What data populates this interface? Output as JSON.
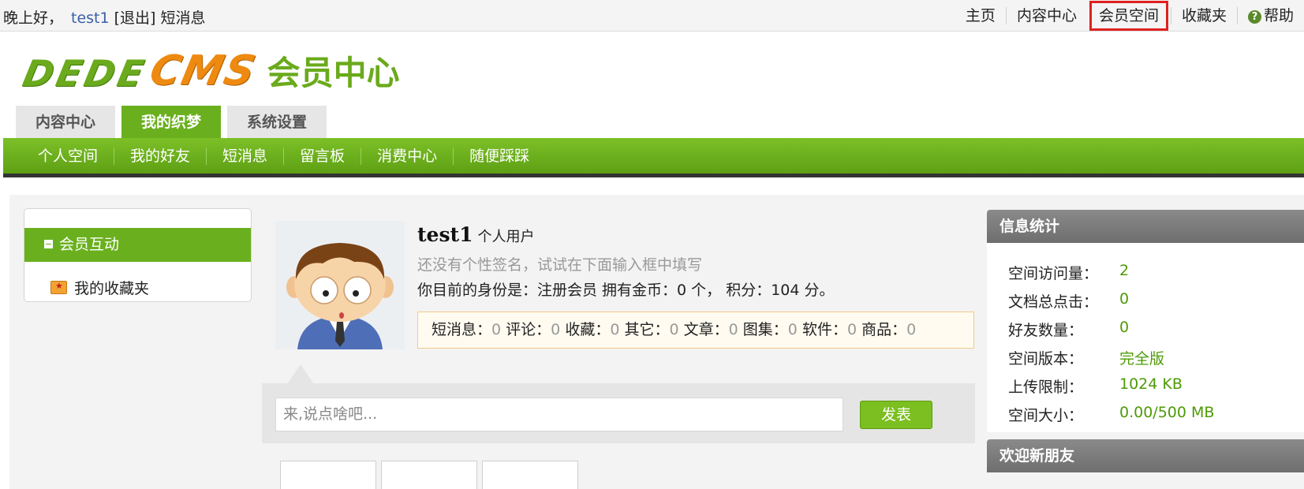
{
  "topbar": {
    "greeting": "晚上好，",
    "username": "test1",
    "logout": "[退出]",
    "messages": "短消息",
    "links": [
      "主页",
      "内容中心",
      "会员空间",
      "收藏夹",
      "帮助"
    ]
  },
  "logo": {
    "brand_left": "DEDE",
    "brand_right": "CMS",
    "subtitle": "会员中心"
  },
  "main_tabs": [
    "内容中心",
    "我的织梦",
    "系统设置"
  ],
  "sub_nav": [
    "个人空间",
    "我的好友",
    "短消息",
    "留言板",
    "消费中心",
    "随便踩踩"
  ],
  "sidebar": {
    "section_title": "会员互动",
    "items": [
      "我的收藏夹"
    ]
  },
  "profile": {
    "name": "test1",
    "type": "个人用户",
    "signature_hint": "还没有个性签名，试试在下面输入框中填写",
    "status_text": "你目前的身份是：注册会员 拥有金币：0 个， 积分：104 分。",
    "counts": [
      {
        "label": "短消息：",
        "value": "0"
      },
      {
        "label": "评论：",
        "value": "0"
      },
      {
        "label": "收藏：",
        "value": "0"
      },
      {
        "label": "其它：",
        "value": "0"
      },
      {
        "label": "文章：",
        "value": "0"
      },
      {
        "label": "图集：",
        "value": "0"
      },
      {
        "label": "软件：",
        "value": "0"
      },
      {
        "label": "商品：",
        "value": "0"
      }
    ]
  },
  "post": {
    "placeholder": "来,说点啥吧...",
    "button": "发表"
  },
  "info_stats": {
    "title": "信息统计",
    "rows": [
      {
        "label": "空间访问量：",
        "value": "2"
      },
      {
        "label": "文档总点击：",
        "value": "0"
      },
      {
        "label": "好友数量：",
        "value": "0"
      },
      {
        "label": "空间版本：",
        "value": "完全版"
      },
      {
        "label": "上传限制：",
        "value": "1024 KB"
      },
      {
        "label": "空间大小：",
        "value": "0.00/500 MB"
      }
    ]
  },
  "welcome": {
    "title": "欢迎新朋友"
  },
  "colors": {
    "brand_green": "#6ab01e",
    "logo_orange": "#ee8a10",
    "highlight_red": "#e02020"
  }
}
